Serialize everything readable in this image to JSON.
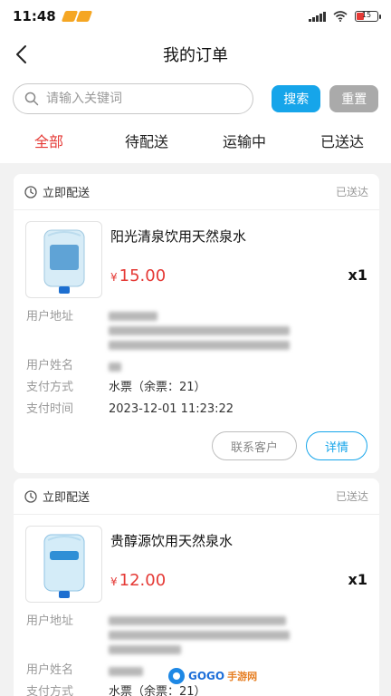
{
  "status_bar": {
    "time": "11:48",
    "battery": "15"
  },
  "header": {
    "title": "我的订单"
  },
  "search": {
    "placeholder": "请输入关键词",
    "search_label": "搜索",
    "reset_label": "重置"
  },
  "tabs": [
    {
      "label": "全部",
      "active": true
    },
    {
      "label": "待配送",
      "active": false
    },
    {
      "label": "运输中",
      "active": false
    },
    {
      "label": "已送达",
      "active": false
    }
  ],
  "orders": [
    {
      "delivery_type": "立即配送",
      "status": "已送达",
      "product_name": "阳光清泉饮用天然泉水",
      "currency": "¥",
      "price": "15.00",
      "quantity": "x1",
      "labels": {
        "address": "用户地址",
        "name": "用户姓名",
        "payment": "支付方式",
        "time": "支付时间"
      },
      "payment_method": "水票（余票：21）",
      "payment_time": "2023-12-01 11:23:22",
      "contact_label": "联系客户",
      "detail_label": "详情"
    },
    {
      "delivery_type": "立即配送",
      "status": "已送达",
      "product_name": "贵醇源饮用天然泉水",
      "currency": "¥",
      "price": "12.00",
      "quantity": "x1",
      "labels": {
        "address": "用户地址",
        "name": "用户姓名",
        "payment": "支付方式"
      },
      "payment_method": "水票（余票：21）"
    }
  ],
  "watermark": {
    "text": "GOGO",
    "sub": "手游网"
  },
  "colors": {
    "accent_blue": "#16a5ea",
    "active_red": "#e53935",
    "reset_gray": "#aaaaaa"
  }
}
